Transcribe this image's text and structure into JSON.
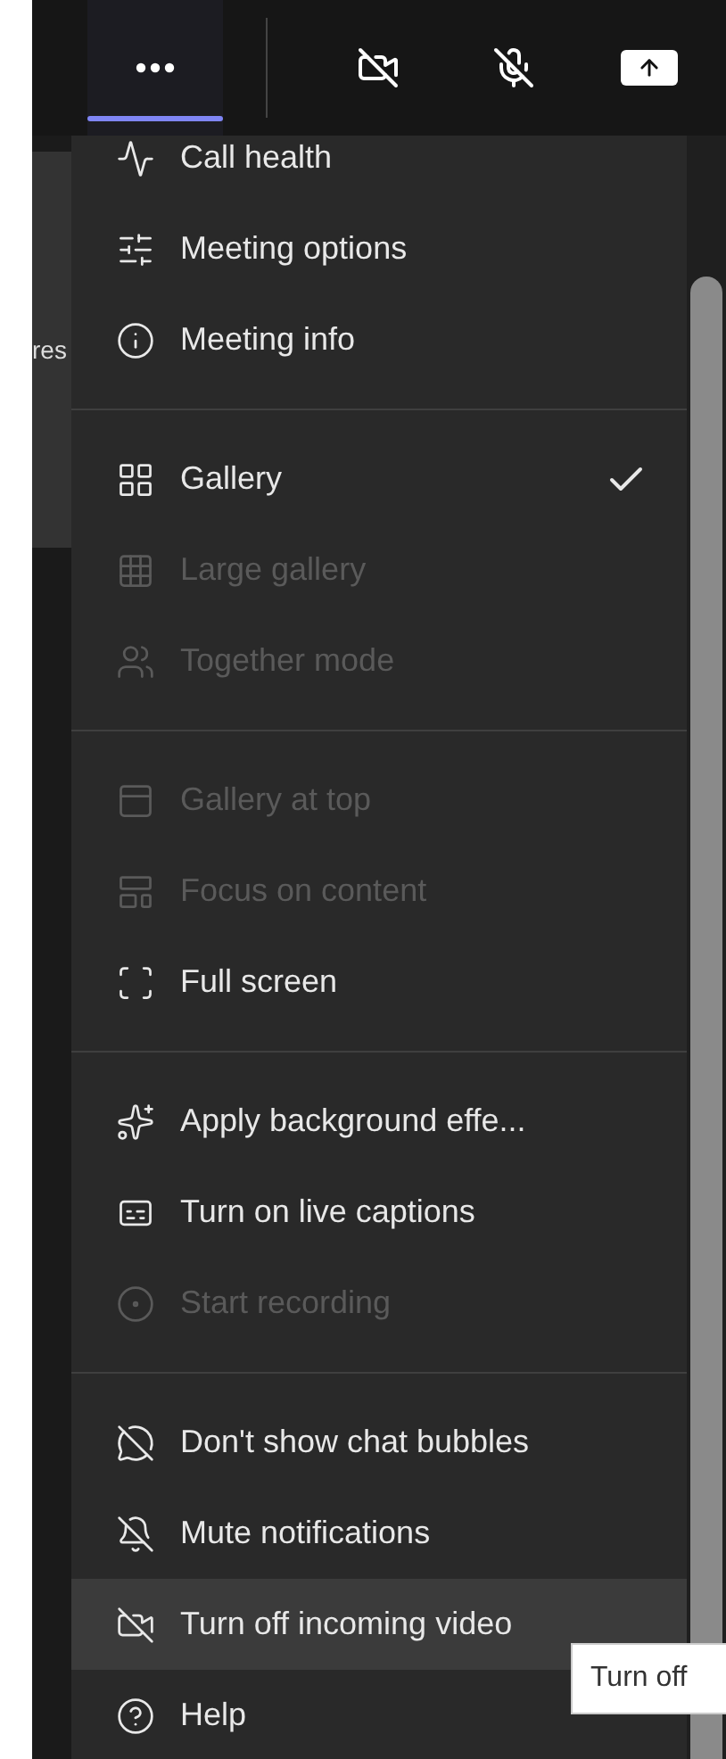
{
  "toolbar": {
    "buttons": [
      {
        "kind": "more",
        "selected": true
      },
      {
        "kind": "camera",
        "selected": false
      },
      {
        "kind": "mic",
        "selected": false
      },
      {
        "kind": "share",
        "selected": false
      }
    ]
  },
  "side_panel": {
    "text": "res"
  },
  "menu": {
    "groups": [
      {
        "items": [
          {
            "label": "Call health",
            "disabled": false,
            "checked": false,
            "hovered": false
          },
          {
            "label": "Meeting options",
            "disabled": false,
            "checked": false,
            "hovered": false
          },
          {
            "label": "Meeting info",
            "disabled": false,
            "checked": false,
            "hovered": false
          }
        ]
      },
      {
        "items": [
          {
            "label": "Gallery",
            "disabled": false,
            "checked": true,
            "hovered": false
          },
          {
            "label": "Large gallery",
            "disabled": true,
            "checked": false,
            "hovered": false
          },
          {
            "label": "Together mode",
            "disabled": true,
            "checked": false,
            "hovered": false
          }
        ]
      },
      {
        "items": [
          {
            "label": "Gallery at top",
            "disabled": true,
            "checked": false,
            "hovered": false
          },
          {
            "label": "Focus on content",
            "disabled": true,
            "checked": false,
            "hovered": false
          },
          {
            "label": "Full screen",
            "disabled": false,
            "checked": false,
            "hovered": false
          }
        ]
      },
      {
        "items": [
          {
            "label": "Apply background effe...",
            "disabled": false,
            "checked": false,
            "hovered": false
          },
          {
            "label": "Turn on live captions",
            "disabled": false,
            "checked": false,
            "hovered": false
          },
          {
            "label": "Start recording",
            "disabled": true,
            "checked": false,
            "hovered": false
          }
        ]
      },
      {
        "items": [
          {
            "label": "Don't show chat bubbles",
            "disabled": false,
            "checked": false,
            "hovered": false
          },
          {
            "label": "Mute notifications",
            "disabled": false,
            "checked": false,
            "hovered": false
          },
          {
            "label": "Turn off incoming video",
            "disabled": false,
            "checked": false,
            "hovered": true
          },
          {
            "label": "Help",
            "disabled": false,
            "checked": false,
            "hovered": false
          }
        ]
      }
    ]
  },
  "tooltip": {
    "text": "Turn off"
  }
}
